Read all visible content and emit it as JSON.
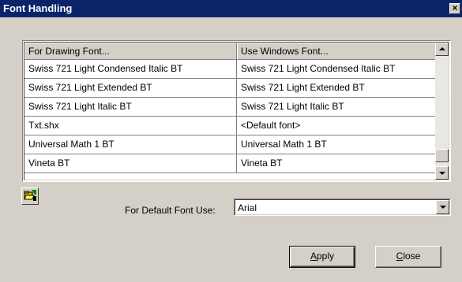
{
  "window": {
    "title": "Font Handling"
  },
  "table": {
    "columns": [
      "For Drawing Font...",
      "Use Windows Font..."
    ],
    "rows": [
      [
        "Swiss 721 Light Condensed Italic BT",
        "Swiss 721 Light Condensed Italic BT"
      ],
      [
        "Swiss 721 Light Extended BT",
        "Swiss 721 Light Extended BT"
      ],
      [
        "Swiss 721 Light Italic BT",
        "Swiss 721 Light Italic BT"
      ],
      [
        "Txt.shx",
        "<Default font>"
      ],
      [
        "Universal Math 1 BT",
        "Universal Math 1 BT"
      ],
      [
        "Vineta BT",
        "Vineta BT"
      ]
    ]
  },
  "default_font": {
    "label": "For Default Font Use:",
    "value": "Arial"
  },
  "buttons": {
    "apply_first": "A",
    "apply_rest": "pply",
    "close_first": "C",
    "close_rest": "lose"
  },
  "icons": {
    "close": "close-icon",
    "folder": "folder-open-icon"
  }
}
